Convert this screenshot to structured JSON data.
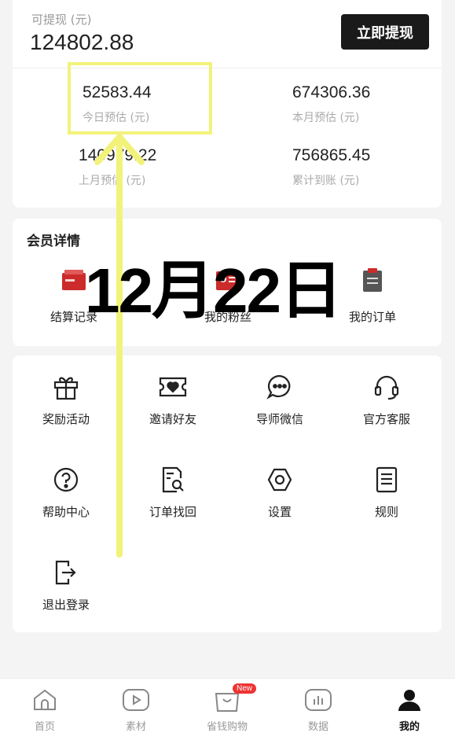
{
  "withdraw": {
    "label": "可提现 (元)",
    "amount": "124802.88",
    "button": "立即提现"
  },
  "stats": [
    {
      "value": "52583.44",
      "label": "今日预估 (元)"
    },
    {
      "value": "674306.36",
      "label": "本月预估 (元)"
    },
    {
      "value": "140979.22",
      "label": "上月预估 (元)"
    },
    {
      "value": "756865.45",
      "label": "累计到账 (元)"
    }
  ],
  "member": {
    "title": "会员详情",
    "items": [
      {
        "label": "结算记录",
        "icon": "settlement-record-icon"
      },
      {
        "label": "我的粉丝",
        "icon": "fans-card-icon"
      },
      {
        "label": "我的订单",
        "icon": "clipboard-icon"
      }
    ]
  },
  "overlay": {
    "date": "12月22日",
    "highlight_color": "#f2f27a"
  },
  "services": [
    {
      "label": "奖励活动",
      "icon": "gift-icon"
    },
    {
      "label": "邀请好友",
      "icon": "ticket-heart-icon"
    },
    {
      "label": "导师微信",
      "icon": "chat-bubble-icon"
    },
    {
      "label": "官方客服",
      "icon": "headset-icon"
    },
    {
      "label": "帮助中心",
      "icon": "question-icon"
    },
    {
      "label": "订单找回",
      "icon": "document-search-icon"
    },
    {
      "label": "设置",
      "icon": "hexagon-settings-icon"
    },
    {
      "label": "规则",
      "icon": "rules-list-icon"
    },
    {
      "label": "退出登录",
      "icon": "logout-icon"
    }
  ],
  "tabbar": [
    {
      "label": "首页",
      "icon": "home-icon"
    },
    {
      "label": "素材",
      "icon": "play-icon"
    },
    {
      "label": "省钱购物",
      "icon": "shopping-bag-icon",
      "badge": "New"
    },
    {
      "label": "数据",
      "icon": "bar-chart-icon"
    },
    {
      "label": "我的",
      "icon": "user-icon",
      "active": true
    }
  ],
  "colors": {
    "accent": "#1a1a1a",
    "badge": "#e33333",
    "member_icon_red": "#cc2b2b"
  }
}
